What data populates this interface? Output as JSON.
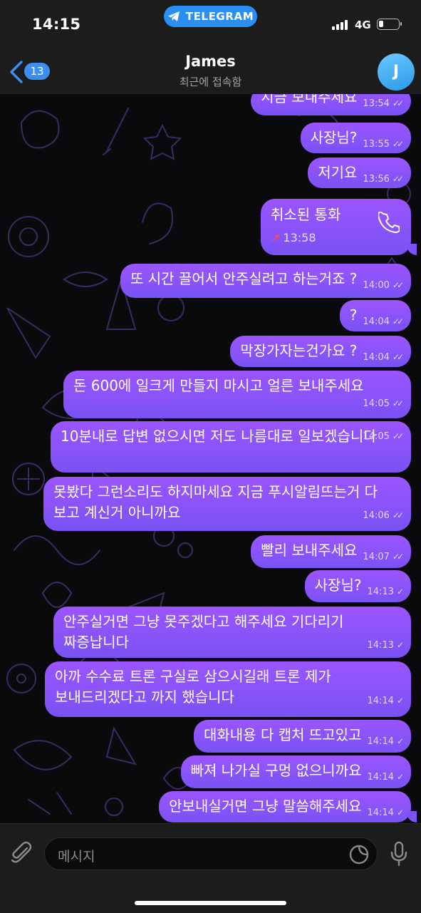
{
  "status_bar": {
    "time": "14:15",
    "app_pill": "TELEGRAM",
    "network": "4G",
    "battery_level": 0.25
  },
  "header": {
    "unread_count": "13",
    "name": "James",
    "status": "최근에 접속함",
    "avatar_letter": "J"
  },
  "messages": [
    {
      "text": "지금 보내주세요",
      "time": "13:54",
      "status": "read"
    },
    {
      "text": "사장님?",
      "time": "13:55",
      "status": "read"
    },
    {
      "text": "저기요",
      "time": "13:56",
      "status": "read"
    },
    {
      "type": "call",
      "text": "취소된 통화",
      "time": "13:58"
    },
    {
      "text": "또 시간 끌어서 안주실려고 하는거죠 ?",
      "time": "14:00",
      "status": "read"
    },
    {
      "text": "?",
      "time": "14:04",
      "status": "read"
    },
    {
      "text": "막장가자는건가요 ?",
      "time": "14:04",
      "status": "read"
    },
    {
      "text": "돈 600에 일크게 만들지 마시고 얼른 보내주세요",
      "time": "14:05",
      "status": "read"
    },
    {
      "text": "10분내로 답변 없으시면 저도 나름대로 일보겠습니다",
      "time": "14:05",
      "status": "read"
    },
    {
      "text": "못봤다 그런소리도 하지마세요 지금 푸시알림뜨는거 다 보고 계신거 아니까요",
      "time": "14:06",
      "status": "read"
    },
    {
      "text": "빨리 보내주세요",
      "time": "14:07",
      "status": "read"
    },
    {
      "text": "사장님?",
      "time": "14:13",
      "status": "sent"
    },
    {
      "text": "안주실거면 그냥 못주겠다고 해주세요 기다리기 짜증납니다",
      "time": "14:13",
      "status": "sent"
    },
    {
      "text": "아까 수수료 트론 구실로 삼으시길래 트론 제가 보내드리겠다고 까지 했습니다",
      "time": "14:14",
      "status": "sent"
    },
    {
      "text": "대화내용 다 캡처 뜨고있고",
      "time": "14:14",
      "status": "sent"
    },
    {
      "text": "빠져 나가실 구멍 없으니까요",
      "time": "14:14",
      "status": "sent"
    },
    {
      "text": "안보내실거면 그냥 말씀해주세요",
      "time": "14:14",
      "status": "sent"
    }
  ],
  "input": {
    "placeholder": "메시지"
  },
  "colors": {
    "bubble_top": "#9b55ff",
    "bubble_bottom": "#7a52f3",
    "accent": "#3c8ef0",
    "bar": "#1c1c1d"
  },
  "icons": [
    "back-chevron-icon",
    "paperclip-icon",
    "sticker-icon",
    "microphone-icon",
    "phone-icon",
    "telegram-plane-icon"
  ]
}
